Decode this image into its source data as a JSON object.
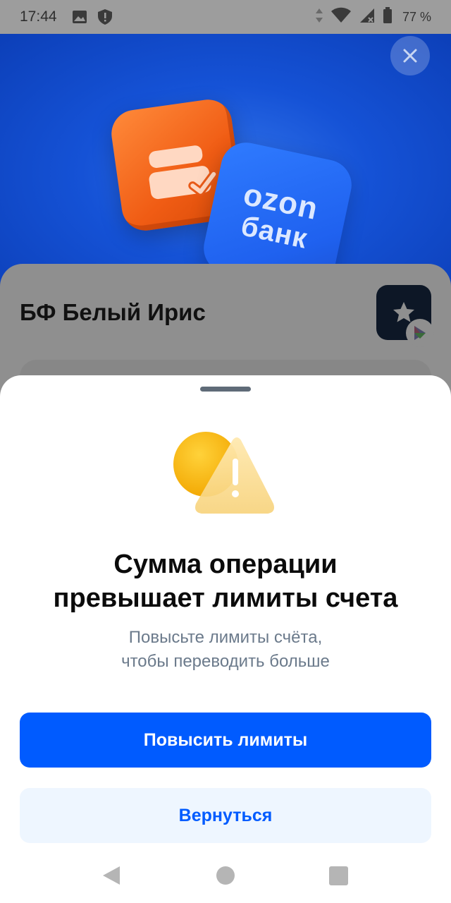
{
  "status_bar": {
    "time": "17:44",
    "battery_percent": "77 %",
    "icons": [
      "gallery-icon",
      "shield-alert-icon",
      "data-arrows-icon",
      "wifi-icon",
      "signal-icon",
      "battery-icon"
    ]
  },
  "hero": {
    "brand_line1": "ozon",
    "brand_line2": "банк",
    "colors": {
      "background": "#1552d6",
      "orange_tile": "#f05c14",
      "blue_tile": "#1f61ef"
    }
  },
  "background_screen": {
    "title": "БФ Белый Ирис"
  },
  "sheet": {
    "title_line1": "Сумма операции",
    "title_line2": "превышает лимиты счета",
    "subtitle_line1": "Повысьте лимиты счёта,",
    "subtitle_line2": "чтобы переводить больше",
    "primary_button": "Повысить лимиты",
    "secondary_button": "Вернуться",
    "colors": {
      "accent": "#005bff",
      "secondary_bg": "#eef6ff",
      "subtitle": "#6b7a8b"
    }
  },
  "nav_bar": {
    "icons": [
      "back-icon",
      "home-icon",
      "recents-icon"
    ]
  }
}
